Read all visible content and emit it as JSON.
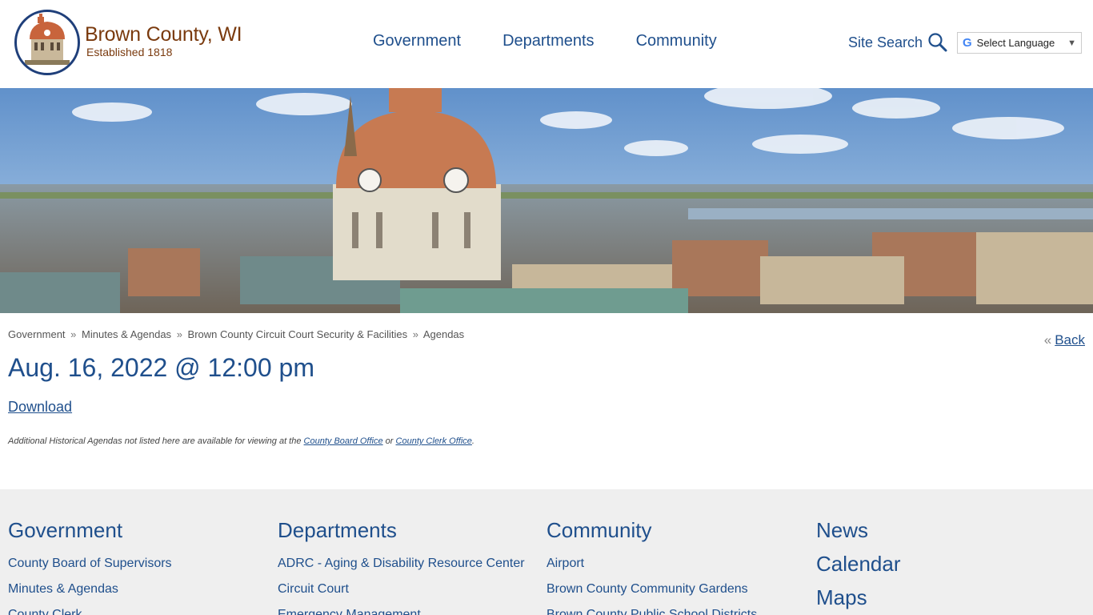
{
  "header": {
    "brand_title": "Brown County, WI",
    "brand_subtitle": "Established 1818",
    "nav": [
      "Government",
      "Departments",
      "Community"
    ],
    "site_search_label": "Site Search",
    "language_label": "Select Language",
    "language_g": "G"
  },
  "breadcrumb": [
    "Government",
    "Minutes & Agendas",
    "Brown County Circuit Court Security & Facilities",
    "Agendas"
  ],
  "breadcrumb_sep": "»",
  "back": {
    "laquo": "«",
    "label": "Back"
  },
  "page_title": "Aug. 16, 2022 @ 12:00 pm",
  "download_label": "Download",
  "note": {
    "prefix": "Additional Historical Agendas not listed here are available for viewing at the",
    "link1": "County Board Office",
    "middle": "or",
    "link2": "County Clerk Office",
    "suffix": "."
  },
  "footer": {
    "government": {
      "title": "Government",
      "links": [
        "County Board of Supervisors",
        "Minutes & Agendas",
        "County Clerk"
      ]
    },
    "departments": {
      "title": "Departments",
      "links": [
        "ADRC - Aging & Disability Resource Center",
        "Circuit Court",
        "Emergency Management"
      ]
    },
    "community": {
      "title": "Community",
      "links": [
        "Airport",
        "Brown County Community Gardens",
        "Brown County Public School Districts"
      ]
    },
    "more": [
      "News",
      "Calendar",
      "Maps"
    ]
  },
  "colors": {
    "brand": "#7a3a0e",
    "link": "#1f4f8c",
    "footer_bg": "#efefef"
  },
  "icons": {
    "search": "magnifier-icon",
    "seal": "courthouse-seal-icon"
  }
}
